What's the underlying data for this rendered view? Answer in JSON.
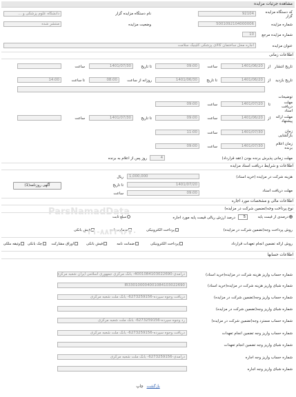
{
  "header": {
    "title": "مشاهده جزئیات مزایده"
  },
  "basic": {
    "code_label": "کد دستگاه مزایده گزار",
    "code_value": "92104",
    "org_label": "نام دستگاه مزایده گزار",
    "org_value": "دانشگاه علوم پزشکی و ...",
    "num_label": "شماره مزایده",
    "num_value": "5001092104000006",
    "status_label": "وضعیت مزایده",
    "status_value": "منتشر شده",
    "ref_label": "شماره مزایده مرجع",
    "ref_value": "10",
    "subject_label": "عنوان مزایده",
    "subject_value": "اجاره محل ساختمان کالای پزشکی کلینیک سلامت"
  },
  "timing": {
    "section_title": "اطلاعات زمانی",
    "publish_label": "تاریخ انتشار",
    "publish_date": "1401/06/20",
    "publish_time": "09:00",
    "publish_to_date": "1401/07/30",
    "publish_to_time": "",
    "visit_label": "تاریخ بازدید",
    "visit_date": "1401/06/20",
    "visit_to_date": "1401/06/30",
    "visit_daily_label": "روزانه از ساعت",
    "visit_from_time": "08:00",
    "visit_to_time": "14:00",
    "time_label": "ساعت",
    "from_label": "از",
    "to_date_label": "تا تاریخ",
    "to_time_label": "تا ساعت",
    "desc_label": "توضیحات",
    "doc_label": "مهلت دریافت اسناد",
    "doc_date": "1401/07/20",
    "doc_time": "09:00",
    "offer_label": "مهلت ارائه پیشنهاد",
    "offer_date": "1401/06/20",
    "offer_time": "09:00",
    "offer_to_date": "1401/07/30",
    "open_label": "زمان بازگشایی",
    "open_date": "1401/07/30",
    "open_time": "11:00",
    "winner_label": "زمان اعلام برنده",
    "winner_date": "1401/07/30",
    "winner_time": "09:00",
    "contract_label": "مهلت زمانی پذیرش برنده بودن (عقد قرارداد)",
    "contract_days": "4",
    "contract_suffix": "روز پس از اعلام به برنده"
  },
  "docs": {
    "section_title": "اطلاعات و شرایط دریافت اسناد مزایده",
    "fee_label": "هزینه شرکت در مزایده (خرید اسناد)",
    "fee_value": "1,000,000",
    "fee_unit": "ریال",
    "deadline_label": "مهلت دریافت اسناد",
    "deadline_to": "تا تاریخ",
    "deadline_date": "1401/07/20",
    "deadline_time_label": "ساعت",
    "deadline_time": "09:00",
    "newspaper_button": "آگهی روزنامه(1)"
  },
  "financial": {
    "section_title": "اطلاعات مالی و مشخصات مورد اجاره",
    "guarantee_type_label": "نوع پرداخت وجه(تضمین شرکت در مزایده)",
    "guarantee_pct_label": "درصدی از قیمت پایه",
    "guarantee_pct": "5",
    "guarantee_pct_suffix": "درصد ارزش ریالی قیمت پایه مورد اجاره",
    "fixed_label": "مبلغ ثابت",
    "payment_label": "روش پرداخت وجه(تضمین شرکت در مزایده)",
    "payment_options": [
      "پرداخت الکترونیکی",
      "ضمانت نامه",
      "فیش بانکی"
    ],
    "guarantee_method_label": "روش ارائه تضمین انجام تعهدات قرارداد",
    "guarantee_methods": [
      "پرداخت الکترونیکی",
      "ضمانت نامه",
      "فیش بانکی",
      "اوراق مشارکت",
      "چک بانکی",
      "وثیقه ملکی"
    ]
  },
  "accounts": {
    "section_title": "اطلاعات حسابها",
    "rows": [
      {
        "label": "شماره حساب واریز هزینه شرکت در مزایده(خرید اسناد)",
        "value": "درآمدی-4001084103022690- بانک مرکزی جمهوری اسلامی ایران شعبه مرکزی"
      },
      {
        "label": "شماره شبای واریز هزینه شرکت در مزایده(خرید اسناد)",
        "value": "IR330100004001084103022690"
      },
      {
        "label": "شماره حساب واریز وجه(تضمین شرکت در مزایده)",
        "value": "دریافت وجوه سپرده-6273259156- بانک ملت شعبه مرکزی"
      },
      {
        "label": "شماره شبای واریز وجه(تضمین شرکت در مزایده)",
        "value": ""
      },
      {
        "label": "شماره حساب مسترد وجه(تضمین شرکت در مزایده)",
        "value": "رد وجوه سپرده-6273259156- بانک ملت شعبه مرکزی"
      },
      {
        "label": "شماره حساب واریز وجه تضمین انجام تعهدات",
        "value": "دریافت وجوه سپرده-6273259156- بانک ملت شعبه مرکزی"
      },
      {
        "label": "شماره شبای واریز وجه تضمین انجام تعهدات",
        "value": ""
      },
      {
        "label": "شماره حساب واریز وجه اجاره",
        "value": "درآمدی-6273259156- بانک ملت شعبه مرکزی"
      },
      {
        "label": "شماره شبای واریز وجه اجاره",
        "value": ""
      }
    ]
  },
  "footer": {
    "print_label": "چاپ",
    "back_label": "بازگشت"
  },
  "watermark": {
    "line1": "ParsNamadData",
    "line2": "۰۲۱-۸۸۳۴۹۶۷۰"
  }
}
